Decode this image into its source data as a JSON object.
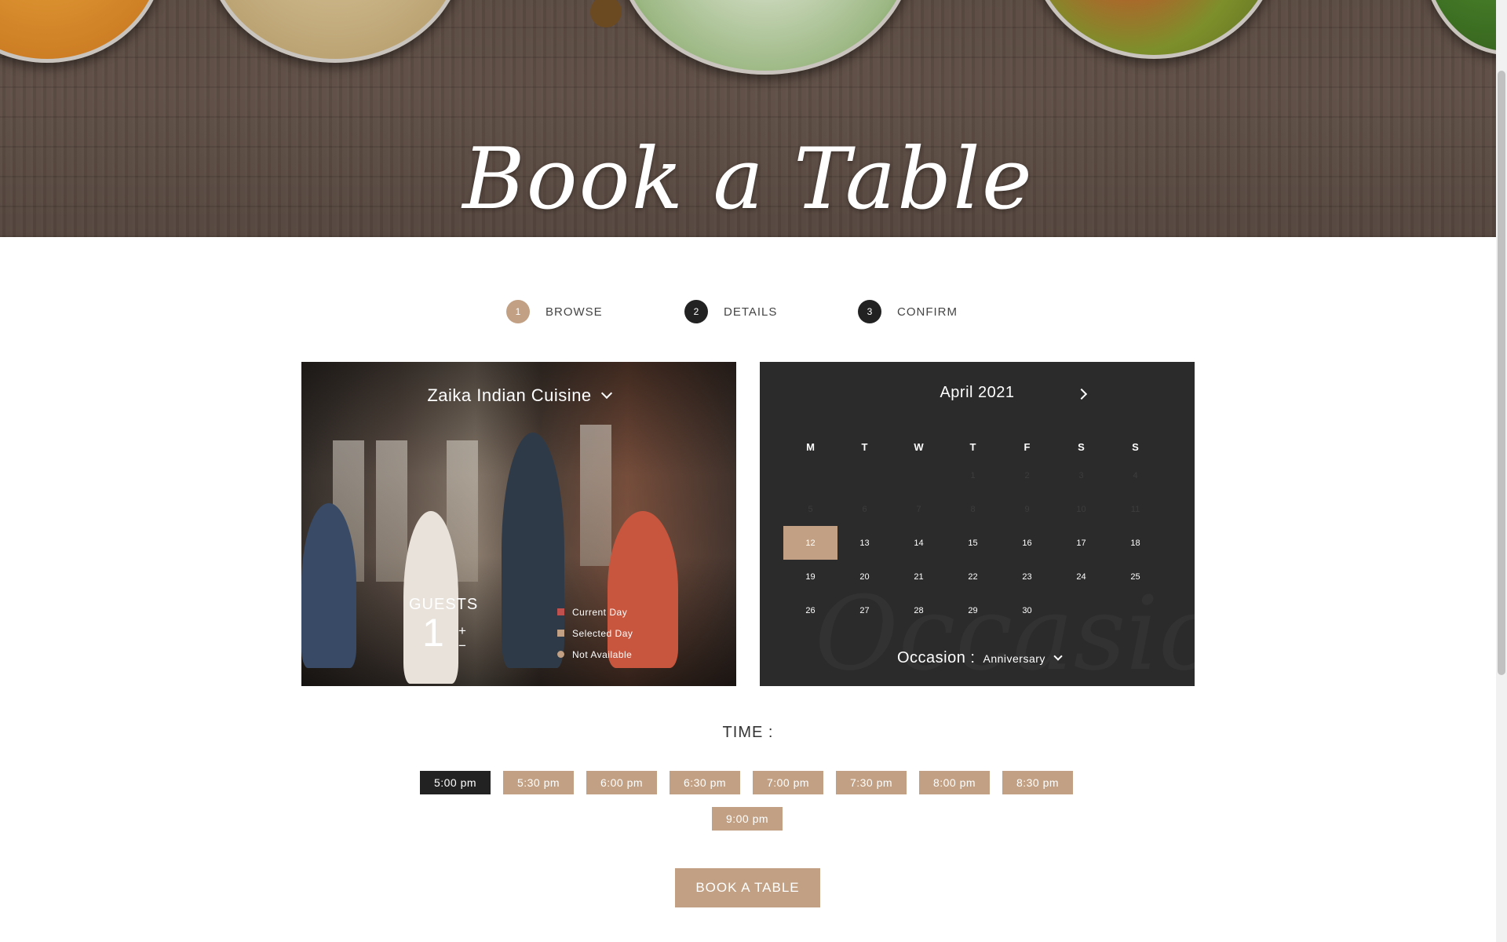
{
  "hero": {
    "title": "Book a Table"
  },
  "steps": [
    {
      "number": "1",
      "label": "BROWSE"
    },
    {
      "number": "2",
      "label": "DETAILS"
    },
    {
      "number": "3",
      "label": "CONFIRM"
    }
  ],
  "restaurant": {
    "selected": "Zaika Indian Cuisine"
  },
  "guests": {
    "label": "GUESTS",
    "count": "1",
    "plus": "+",
    "minus": "−"
  },
  "legend": [
    {
      "label": "Current Day",
      "color": "#c0504d"
    },
    {
      "label": "Selected Day",
      "color": "#c2a083"
    },
    {
      "label": "Not Available",
      "color": "#c2a083"
    }
  ],
  "calendar": {
    "month": "April 2021",
    "weekdays": [
      "M",
      "T",
      "W",
      "T",
      "F",
      "S",
      "S"
    ],
    "days": [
      [
        "",
        "",
        "",
        "1",
        "2",
        "3",
        "4"
      ],
      [
        "5",
        "6",
        "7",
        "8",
        "9",
        "10",
        "11"
      ],
      [
        "12",
        "13",
        "14",
        "15",
        "16",
        "17",
        "18"
      ],
      [
        "19",
        "20",
        "21",
        "22",
        "23",
        "24",
        "25"
      ],
      [
        "26",
        "27",
        "28",
        "29",
        "30",
        "",
        ""
      ]
    ],
    "selected_day": "12",
    "unavailable_through": "11"
  },
  "occasion": {
    "label": "Occasion :",
    "value": "Anniversary"
  },
  "time": {
    "label": "TIME :",
    "slots": [
      "5:00 pm",
      "5:30 pm",
      "6:00 pm",
      "6:30 pm",
      "7:00 pm",
      "7:30 pm",
      "8:00 pm",
      "8:30 pm",
      "9:00 pm"
    ],
    "selected": "5:00 pm"
  },
  "book_button": {
    "label": "BOOK A TABLE"
  },
  "colors": {
    "accent": "#c2a083",
    "dark": "#222222",
    "panel": "#2b2b2b",
    "current_day": "#c0504d"
  }
}
